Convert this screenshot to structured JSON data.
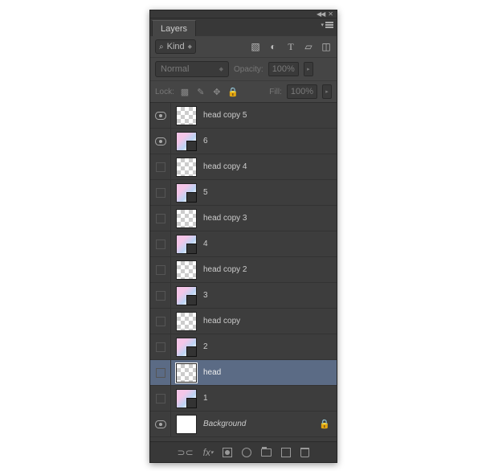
{
  "panel": {
    "title": "Layers",
    "filter": {
      "kind_label": "Kind"
    },
    "blend": {
      "mode": "Normal",
      "opacity_label": "Opacity:",
      "opacity_value": "100%"
    },
    "lock": {
      "label": "Lock:",
      "fill_label": "Fill:",
      "fill_value": "100%"
    },
    "layers": [
      {
        "name": "head copy 5",
        "visible": true,
        "thumb": "checker",
        "selected": false,
        "locked": false
      },
      {
        "name": "6",
        "visible": true,
        "thumb": "colorful",
        "selected": false,
        "locked": false,
        "smart": true
      },
      {
        "name": "head copy 4",
        "visible": false,
        "thumb": "checker",
        "selected": false,
        "locked": false
      },
      {
        "name": "5",
        "visible": false,
        "thumb": "colorful",
        "selected": false,
        "locked": false,
        "smart": true
      },
      {
        "name": "head copy 3",
        "visible": false,
        "thumb": "checker",
        "selected": false,
        "locked": false
      },
      {
        "name": "4",
        "visible": false,
        "thumb": "colorful",
        "selected": false,
        "locked": false,
        "smart": true
      },
      {
        "name": "head copy 2",
        "visible": false,
        "thumb": "checker",
        "selected": false,
        "locked": false
      },
      {
        "name": "3",
        "visible": false,
        "thumb": "colorful",
        "selected": false,
        "locked": false,
        "smart": true
      },
      {
        "name": "head copy",
        "visible": false,
        "thumb": "checker",
        "selected": false,
        "locked": false
      },
      {
        "name": "2",
        "visible": false,
        "thumb": "colorful",
        "selected": false,
        "locked": false,
        "smart": true
      },
      {
        "name": "head",
        "visible": false,
        "thumb": "checker",
        "selected": true,
        "locked": false
      },
      {
        "name": "1",
        "visible": false,
        "thumb": "colorful",
        "selected": false,
        "locked": false,
        "smart": true
      },
      {
        "name": "Background",
        "visible": true,
        "thumb": "white",
        "selected": false,
        "locked": true,
        "italic": true
      }
    ]
  }
}
